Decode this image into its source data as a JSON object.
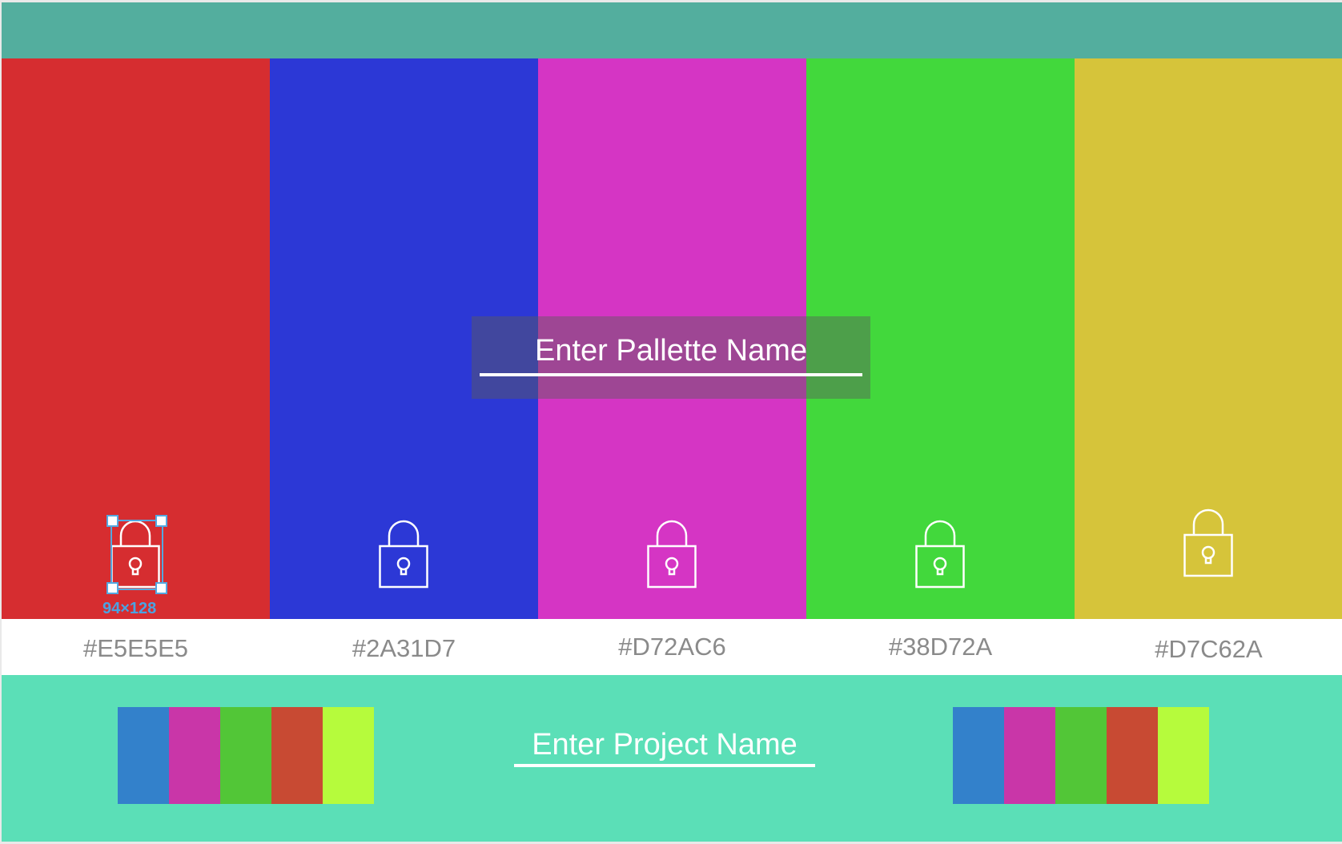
{
  "colors": {
    "topbar": "#53AE9E",
    "footer": "#5BDFB7"
  },
  "swatches": [
    {
      "color": "#D62D30",
      "hex_label": "#E5E5E5",
      "lock_icon": "padlock-icon"
    },
    {
      "color": "#2C38D6",
      "hex_label": "#2A31D7",
      "lock_icon": "padlock-icon"
    },
    {
      "color": "#D535C4",
      "hex_label": "#D72AC6",
      "lock_icon": "padlock-icon"
    },
    {
      "color": "#42D83C",
      "hex_label": "#38D72A",
      "lock_icon": "padlock-icon"
    },
    {
      "color": "#D6C43A",
      "hex_label": "#D7C62A",
      "lock_icon": "padlock-icon"
    }
  ],
  "selection": {
    "dimension_label": "94×128"
  },
  "palette_name": {
    "placeholder": "Enter Pallette Name"
  },
  "footer": {
    "project_name_placeholder": "Enter Project Name",
    "left_palette": [
      "#3381CB",
      "#C936A8",
      "#52C637",
      "#C84A33",
      "#B6FB3C"
    ],
    "right_palette": [
      "#3381CB",
      "#C936A8",
      "#52C637",
      "#C84A33",
      "#B6FB3C"
    ]
  }
}
